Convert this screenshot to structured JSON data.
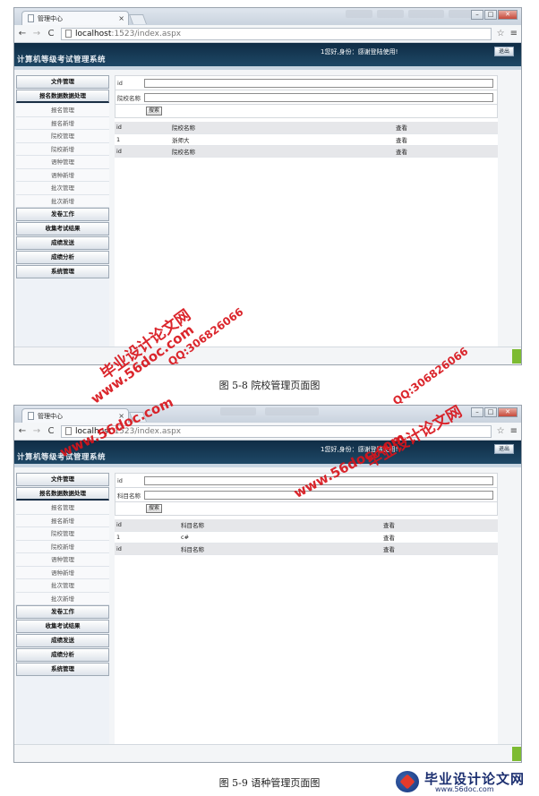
{
  "browser": {
    "tab_title": "管理中心",
    "tab_close": "×",
    "url_host": "localhost",
    "url_path": ":1523/index.aspx",
    "icons": {
      "back": "left-arrow-icon",
      "forward": "right-arrow-icon",
      "reload": "reload-icon",
      "bookmark": "star-icon",
      "menu": "hamburger-icon"
    }
  },
  "app": {
    "title": "计算机等级考试管理系统",
    "greeting": "1您好,身份：感谢登陆使用!",
    "logout": "退出"
  },
  "sidebar": {
    "headers_top": [
      "文件管理",
      "报名数据数据处理"
    ],
    "sub_items": [
      "报名管理",
      "报名新增",
      "院校管理",
      "院校新增",
      "语种管理",
      "语种新增",
      "批次管理",
      "批次新增"
    ],
    "headers_bottom": [
      "发卷工作",
      "收集考试结果",
      "成绩发送",
      "成绩分析",
      "系统管理"
    ]
  },
  "screen1": {
    "form": {
      "id_label": "id",
      "name_label": "院校名称",
      "search_button": "搜索"
    },
    "table": {
      "header": [
        "id",
        "院校名称",
        "查看"
      ],
      "rows": [
        [
          "1",
          "浙师大",
          "查看"
        ]
      ],
      "footer": [
        "id",
        "院校名称",
        "查看"
      ]
    },
    "caption": "图 5-8  院校管理页面图"
  },
  "screen2": {
    "form": {
      "id_label": "id",
      "name_label": "科目名称",
      "search_button": "搜索"
    },
    "table": {
      "header": [
        "id",
        "科目名称",
        "查看"
      ],
      "rows": [
        [
          "1",
          "c#",
          "查看"
        ]
      ],
      "footer": [
        "id",
        "科目名称",
        "查看"
      ]
    },
    "caption": "图 5-9  语种管理页面图"
  },
  "watermarks": {
    "url": "www.56doc.com",
    "site": "毕业设计论文网",
    "qq": "QQ:306826066"
  },
  "brand": {
    "name": "毕业设计论文网",
    "url": "www.56doc.com"
  }
}
